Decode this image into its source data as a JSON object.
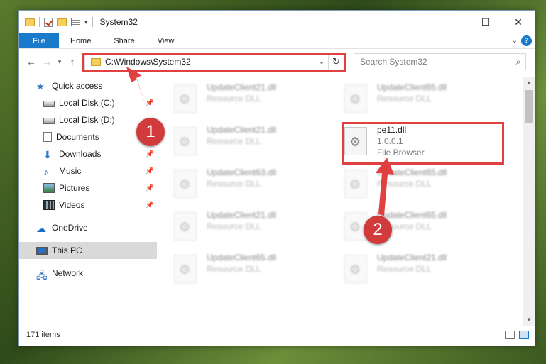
{
  "window": {
    "title": "System32",
    "controls": {
      "minimize": "—",
      "maximize": "☐",
      "close": "✕"
    }
  },
  "ribbon": {
    "tabs": [
      "File",
      "Home",
      "Share",
      "View"
    ],
    "help": "?"
  },
  "navbar": {
    "address_path": "C:\\Windows\\System32",
    "search_placeholder": "Search System32"
  },
  "sidebar": {
    "items": [
      {
        "label": "Quick access",
        "icon": "star-icon",
        "pinned": false
      },
      {
        "label": "Local Disk (C:)",
        "icon": "disk-icon",
        "pinned": true
      },
      {
        "label": "Local Disk (D:)",
        "icon": "disk-icon",
        "pinned": true
      },
      {
        "label": "Documents",
        "icon": "documents-icon",
        "pinned": true
      },
      {
        "label": "Downloads",
        "icon": "download-icon",
        "pinned": true
      },
      {
        "label": "Music",
        "icon": "music-icon",
        "pinned": true
      },
      {
        "label": "Pictures",
        "icon": "pictures-icon",
        "pinned": true
      },
      {
        "label": "Videos",
        "icon": "videos-icon",
        "pinned": true
      },
      {
        "label": "OneDrive",
        "icon": "cloud-icon",
        "pinned": false
      },
      {
        "label": "This PC",
        "icon": "computer-icon",
        "pinned": false,
        "selected": true
      },
      {
        "label": "Network",
        "icon": "network-icon",
        "pinned": false
      }
    ]
  },
  "files": [
    {
      "name": "UpdateClient21.dll",
      "type": "Resource DLL"
    },
    {
      "name": "UpdateClient65.dll",
      "type": "Resource DLL"
    },
    {
      "name": "UpdateClient21.dll",
      "type": "Resource DLL"
    },
    {
      "name": "pe11.dll",
      "version": "1.0.0.1",
      "type": "File Browser",
      "highlighted": true
    },
    {
      "name": "UpdateClient63.dll",
      "type": "Resource DLL"
    },
    {
      "name": "UpdateClient65.dll",
      "type": "Resource DLL"
    },
    {
      "name": "UpdateClient21.dll",
      "type": "Resource DLL"
    },
    {
      "name": "UpdateClient65.dll",
      "type": "Resource DLL"
    },
    {
      "name": "UpdateClient65.dll",
      "type": "Resource DLL"
    },
    {
      "name": "UpdateClient21.dll",
      "type": "Resource DLL"
    }
  ],
  "status": {
    "item_count": "171 items"
  },
  "annotations": {
    "step1": "1",
    "step2": "2",
    "color": "#e04040"
  }
}
